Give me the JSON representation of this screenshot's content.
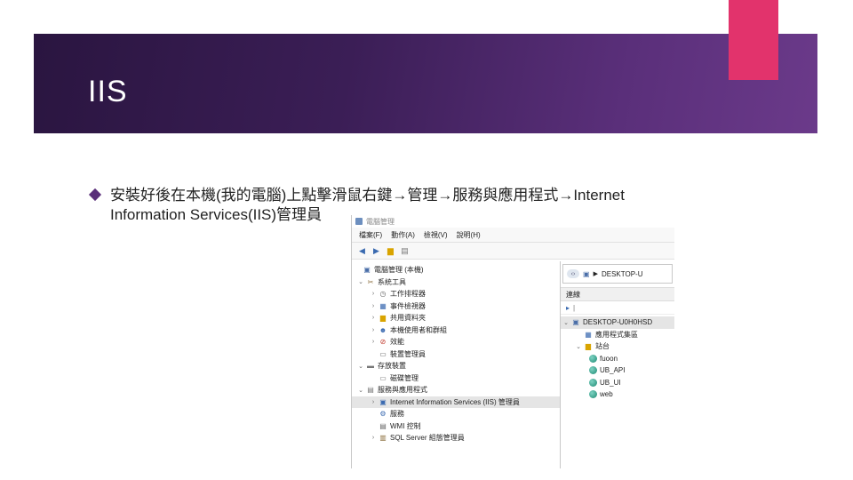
{
  "slide": {
    "title": "IIS",
    "bullet_line1": "安裝好後在本機(我的電腦)上點擊滑鼠右鍵→管理→服務與應用程式→Internet",
    "bullet_line2": "Information Services(IIS)管理員",
    "colors": {
      "banner": "#3b1e56",
      "accent": "#e2336c",
      "text": "#222222"
    }
  },
  "window": {
    "title": "電腦管理",
    "menu": [
      "檔案(F)",
      "動作(A)",
      "檢視(V)",
      "說明(H)"
    ],
    "toolbar_icons": [
      "back-icon",
      "forward-icon",
      "folder-icon",
      "properties-icon"
    ],
    "tree": [
      {
        "label": "電腦管理 (本機)",
        "icon": "computer-icon"
      },
      {
        "label": "系統工具",
        "icon": "tools-icon"
      },
      {
        "label": "工作排程器",
        "icon": "clock-icon"
      },
      {
        "label": "事件檢視器",
        "icon": "event-icon"
      },
      {
        "label": "共用資料夾",
        "icon": "shared-folder-icon"
      },
      {
        "label": "本機使用者和群組",
        "icon": "users-icon"
      },
      {
        "label": "效能",
        "icon": "performance-icon"
      },
      {
        "label": "裝置管理員",
        "icon": "device-icon"
      },
      {
        "label": "存放裝置",
        "icon": "storage-icon"
      },
      {
        "label": "磁碟管理",
        "icon": "disk-icon"
      },
      {
        "label": "服務與應用程式",
        "icon": "services-icon"
      },
      {
        "label": "Internet Information Services (IIS) 管理員",
        "icon": "iis-icon"
      },
      {
        "label": "服務",
        "icon": "services-gear-icon"
      },
      {
        "label": "WMI 控制",
        "icon": "wmi-icon"
      },
      {
        "label": "SQL Server 組態管理員",
        "icon": "sql-icon"
      }
    ],
    "right": {
      "address": "DESKTOP-U",
      "connections_header": "連線",
      "tree": [
        {
          "label": "DESKTOP-U0H0HSD"
        },
        {
          "label": "應用程式集區"
        },
        {
          "label": "站台"
        },
        {
          "label": "fuoon"
        },
        {
          "label": "UB_API"
        },
        {
          "label": "UB_UI"
        },
        {
          "label": "web"
        }
      ]
    }
  }
}
